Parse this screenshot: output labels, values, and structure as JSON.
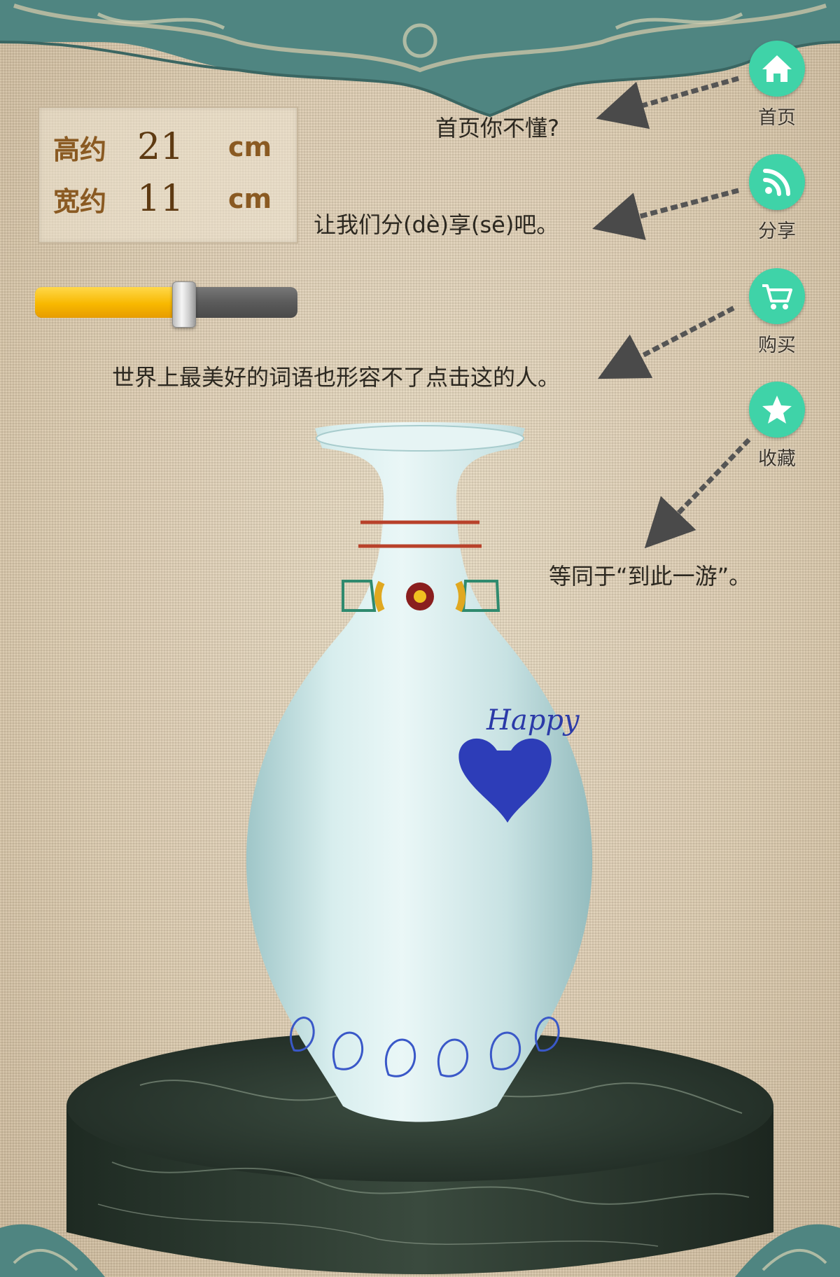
{
  "size_panel": {
    "height_label": "高约",
    "height_value": "21",
    "height_unit": "cm",
    "width_label": "宽约",
    "width_value": "11",
    "width_unit": "cm"
  },
  "slider": {
    "value": 0.57
  },
  "side_menu": [
    {
      "label": "首页",
      "icon": "home-icon"
    },
    {
      "label": "分享",
      "icon": "rss-share-icon"
    },
    {
      "label": "购买",
      "icon": "cart-icon"
    },
    {
      "label": "收藏",
      "icon": "star-icon"
    }
  ],
  "hints": {
    "home": "首页你不懂?",
    "share": "让我们分(dè)享(sē)吧。",
    "buy": "世界上最美好的词语也形容不了点击这的人。",
    "favorite": "等同于“到此一游”。"
  },
  "vase": {
    "text": "Happy"
  },
  "colors": {
    "accent_green": "#3fd3a8",
    "slider_yellow": "#f8b800",
    "label_brown": "#8a5a22",
    "ornament_teal": "#4f8581"
  }
}
